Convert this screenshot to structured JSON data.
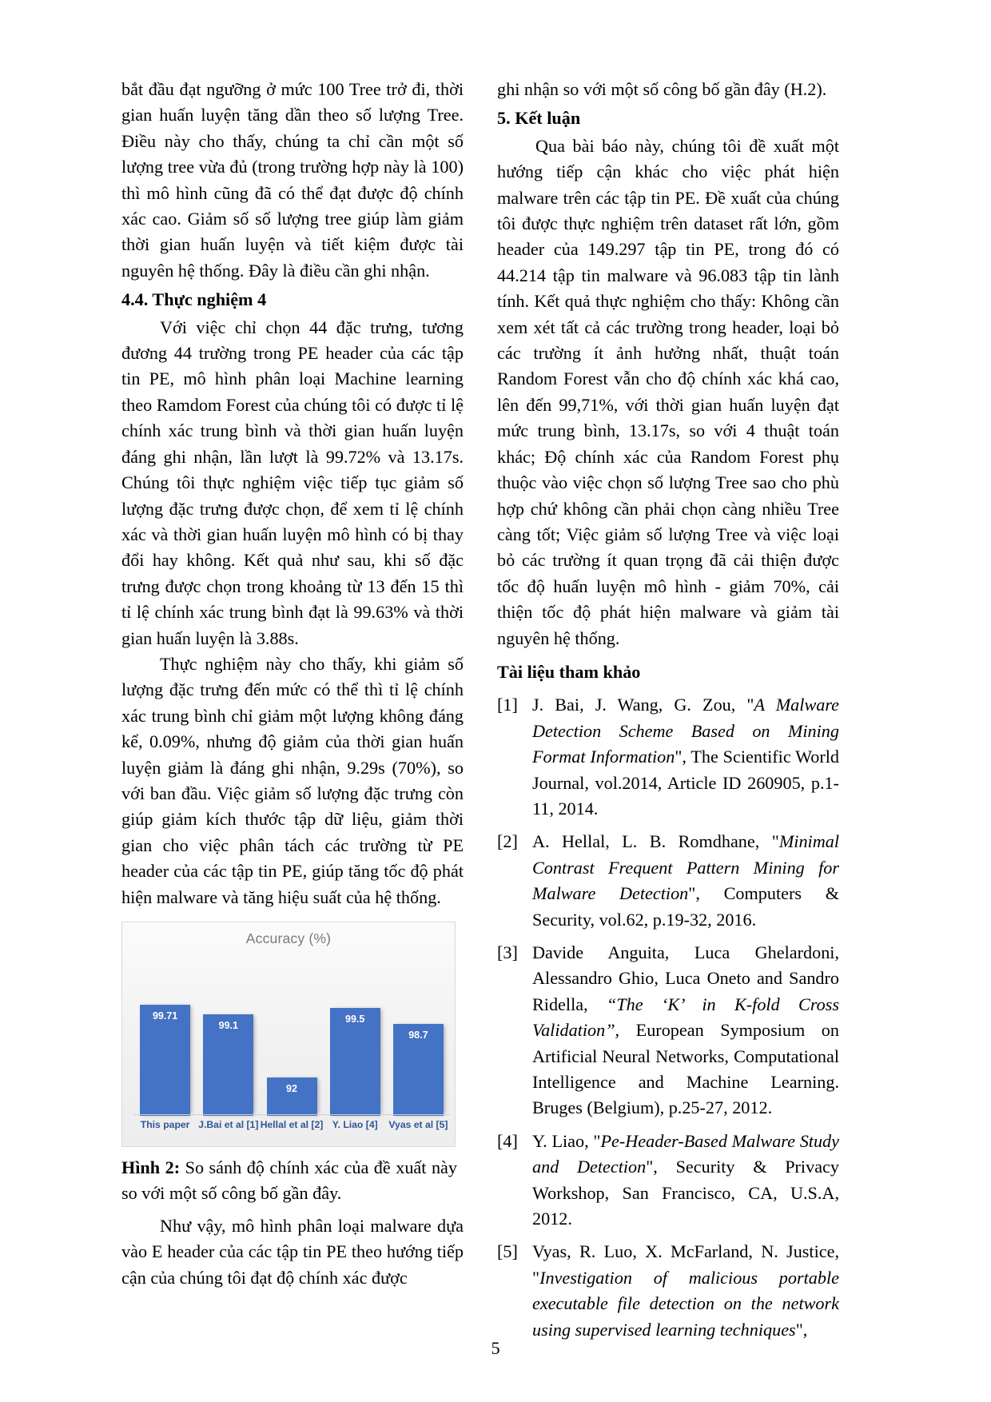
{
  "page_number": "5",
  "left_column": {
    "para_1": "bắt đầu đạt ngưỡng ở mức 100 Tree trở đi, thời gian huấn luyện tăng dần theo số lượng Tree. Điều này cho thấy, chúng ta chỉ cần một số lượng tree vừa đủ (trong trường hợp này là 100) thì mô hình cũng đã có thể đạt được độ chính xác cao. Giảm số số lượng tree giúp làm giảm thời gian huấn luyện và tiết kiệm được tài nguyên hệ thống. Đây là điều cần ghi nhận.",
    "heading_4_4": "4.4. Thực nghiệm 4",
    "para_2": "Với việc chỉ chọn 44 đặc trưng, tương đương 44 trường trong PE header của các tập tin PE, mô hình phân loại Machine learning theo Ramdom Forest của chúng tôi có được tỉ lệ chính xác trung bình và thời gian huấn luyện đáng ghi nhận, lần lượt là 99.72% và 13.17s. Chúng tôi thực nghiệm việc tiếp tục giảm số lượng đặc trưng được chọn, để xem tỉ lệ chính xác và thời gian huấn luyện mô hình có bị thay đổi hay không. Kết quả như sau, khi số đặc trưng được chọn trong khoảng từ 13 đến 15 thì tỉ lệ chính xác trung bình đạt là 99.63% và thời gian huấn luyện là 3.88s.",
    "para_3": "Thực nghiệm này cho thấy, khi giảm số lượng đặc trưng đến mức có thể thì tỉ lệ chính xác trung bình chỉ giảm một lượng không đáng kể, 0.09%, nhưng độ giảm của thời gian huấn luyện giảm là đáng ghi nhận, 9.29s (70%), so với ban đầu. Việc giảm số lượng đặc trưng còn giúp giảm kích thước tập dữ liệu, giảm thời gian cho việc phân tách các trường từ PE header của các tập tin PE, giúp tăng tốc độ phát hiện malware và tăng hiệu suất của hệ thống.",
    "figure_caption_label": "Hình 2:",
    "figure_caption_text": " So sánh độ chính xác của đề xuất này so với một số công bố gần đây.",
    "para_4": "Như vậy, mô hình phân loại malware dựa vào E header của các tập tin PE theo hướng tiếp cận của chúng tôi đạt độ chính xác được"
  },
  "right_column": {
    "para_continued": "ghi nhận so với một số công bố gần đây (H.2).",
    "heading_5": "5. Kết luận",
    "para_conclusion": "Qua bài báo này, chúng tôi đề xuất một hướng tiếp cận khác cho việc phát hiện malware trên các tập tin PE. Đề xuất của chúng tôi được thực nghiệm trên dataset rất lớn, gồm header của 149.297 tập tin PE, trong đó có 44.214 tập tin malware và 96.083 tập tin lành tính. Kết quả thực nghiệm cho thấy: Không cần xem xét tất cả các trường trong header, loại bỏ các trường ít ảnh hưởng nhất, thuật toán Random Forest vẫn cho độ chính xác khá cao, lên đến 99,71%, với thời gian huấn luyện đạt mức trung bình, 13.17s, so với 4 thuật toán khác; Độ chính xác của Random Forest phụ thuộc vào việc chọn số lượng Tree sao cho phù hợp chứ không cần phải chọn càng nhiều Tree càng tốt; Việc giảm số lượng Tree và việc loại bỏ các trường ít quan trọng đã cải thiện được tốc độ huấn luyện mô hình - giảm 70%, cải thiện tốc độ phát hiện malware và giảm tài nguyên hệ thống.",
    "references_heading": "Tài liệu tham khảo",
    "references": [
      {
        "num": "[1]",
        "parts": [
          {
            "text": "J. Bai, J. Wang, G. Zou, \"",
            "italic": false
          },
          {
            "text": "A Malware Detection Scheme Based on Mining Format Information",
            "italic": true
          },
          {
            "text": "\", The Scientific World Journal, vol.2014, Article ID 260905, p.1-11, 2014.",
            "italic": false
          }
        ]
      },
      {
        "num": "[2]",
        "parts": [
          {
            "text": "A. Hellal, L. B. Romdhane, \"",
            "italic": false
          },
          {
            "text": "Minimal Contrast Frequent Pattern Mining for Malware Detection",
            "italic": true
          },
          {
            "text": "\", Computers & Security, vol.62, p.19-32, 2016.",
            "italic": false
          }
        ]
      },
      {
        "num": "[3]",
        "parts": [
          {
            "text": " Davide Anguita, Luca Ghelardoni, Alessandro Ghio, Luca Oneto and Sandro Ridella, ",
            "italic": false
          },
          {
            "text": "“The ‘K’ in K-fold Cross Validation”,",
            "italic": true
          },
          {
            "text": " European Symposium on Artificial Neural Networks, Computational Intelligence and Machine Learning. Bruges (Belgium), p.25-27, 2012.",
            "italic": false
          }
        ]
      },
      {
        "num": "[4]",
        "parts": [
          {
            "text": "Y. Liao, \"",
            "italic": false
          },
          {
            "text": "Pe-Header-Based Malware Study and Detection",
            "italic": true
          },
          {
            "text": "\", Security & Privacy Workshop, San Francisco, CA, U.S.A, 2012.",
            "italic": false
          }
        ]
      },
      {
        "num": "[5]",
        "parts": [
          {
            "text": "Vyas, R. Luo, X. McFarland, N. Justice, \"",
            "italic": false
          },
          {
            "text": "Investigation of malicious portable executable file detection on the network using supervised learning techniques",
            "italic": true
          },
          {
            "text": "\",",
            "italic": false
          }
        ]
      }
    ]
  },
  "chart_data": {
    "type": "bar",
    "title": "Accuracy (%)",
    "xlabel": "",
    "ylabel": "",
    "ylim": [
      0,
      100
    ],
    "grid": false,
    "legend": "none",
    "bar_color": "#4472c4",
    "label_color": "#2f5597",
    "categories": [
      "This paper",
      "J.Bai et al [1]",
      "Hellal et al [2]",
      "Y. Liao [4]",
      "Vyas et al [5]"
    ],
    "values": [
      99.71,
      99.1,
      92,
      99.5,
      98.7
    ],
    "value_labels": [
      "99.71",
      "99.1",
      "92",
      "99.5",
      "98.7"
    ]
  }
}
